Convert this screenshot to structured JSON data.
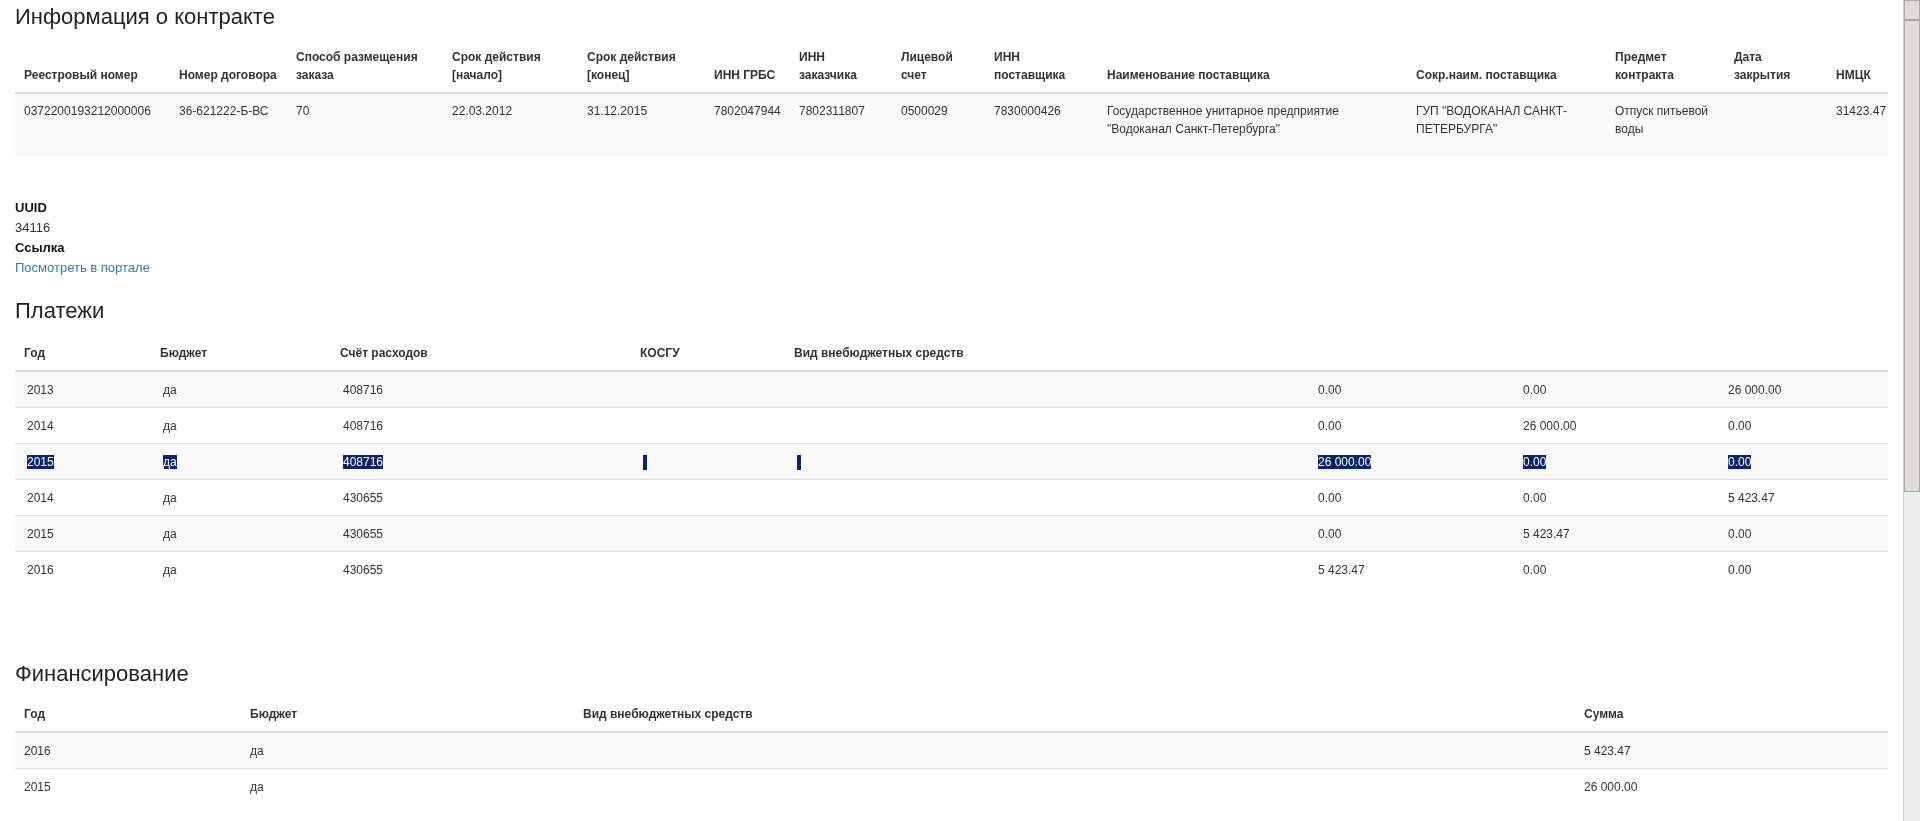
{
  "contract": {
    "title": "Информация о контракте",
    "columns": [
      "Реестровый номер",
      "Номер договора",
      "Способ размещения заказа",
      "Срок действия [начало]",
      "Срок действия [конец]",
      "ИНН ГРБС",
      "ИНН заказчика",
      "Лицевой счет",
      "ИНН поставщика",
      "Наименование поставщика",
      "Сокр.наим. поставщика",
      "Предмет контракта",
      "Дата закрытия",
      "НМЦК"
    ],
    "rows": [
      [
        "0372200193212000006",
        "36-621222-Б-ВС",
        "70",
        "22.03.2012",
        "31.12.2015",
        "7802047944",
        "7802311807",
        "0500029",
        "7830000426",
        "Государственное унитарное предприятие \"Водоканал Санкт-Петербурга\"",
        "ГУП \"ВОДОКАНАЛ САНКТ-ПЕТЕРБУРГА\"",
        "Отпуск питьевой воды",
        "",
        "31423.47"
      ]
    ]
  },
  "details": [
    {
      "label": "UUID",
      "value": "34116",
      "kind": "text"
    },
    {
      "label": "Ссылка",
      "value": "Посмотреть в портале",
      "kind": "link"
    }
  ],
  "payments": {
    "title": "Платежи",
    "columns": [
      "Год",
      "Бюджет",
      "Счёт расходов",
      "КОСГУ",
      "Вид внебюджетных средств",
      "",
      "",
      ""
    ],
    "rows": [
      {
        "cells": [
          "2013",
          "да",
          "408716",
          "",
          "",
          "0.00",
          "0.00",
          "26 000.00"
        ],
        "selected": false
      },
      {
        "cells": [
          "2014",
          "да",
          "408716",
          "",
          "",
          "0.00",
          "26 000.00",
          "0.00"
        ],
        "selected": false
      },
      {
        "cells": [
          "2015",
          "да",
          "408716",
          "",
          "",
          "26 000.00",
          "0.00",
          "0.00"
        ],
        "selected": true
      },
      {
        "cells": [
          "2014",
          "да",
          "430655",
          "",
          "",
          "0.00",
          "0.00",
          "5 423.47"
        ],
        "selected": false
      },
      {
        "cells": [
          "2015",
          "да",
          "430655",
          "",
          "",
          "0.00",
          "5 423.47",
          "0.00"
        ],
        "selected": false
      },
      {
        "cells": [
          "2016",
          "да",
          "430655",
          "",
          "",
          "5 423.47",
          "0.00",
          "0.00"
        ],
        "selected": false
      }
    ]
  },
  "financing": {
    "title": "Финансирование",
    "columns": [
      "Год",
      "Бюджет",
      "Вид внебюджетных средств",
      "Сумма"
    ],
    "rows": [
      [
        "2016",
        "да",
        "",
        "5 423.47"
      ],
      [
        "2015",
        "да",
        "",
        "26 000.00"
      ]
    ]
  }
}
